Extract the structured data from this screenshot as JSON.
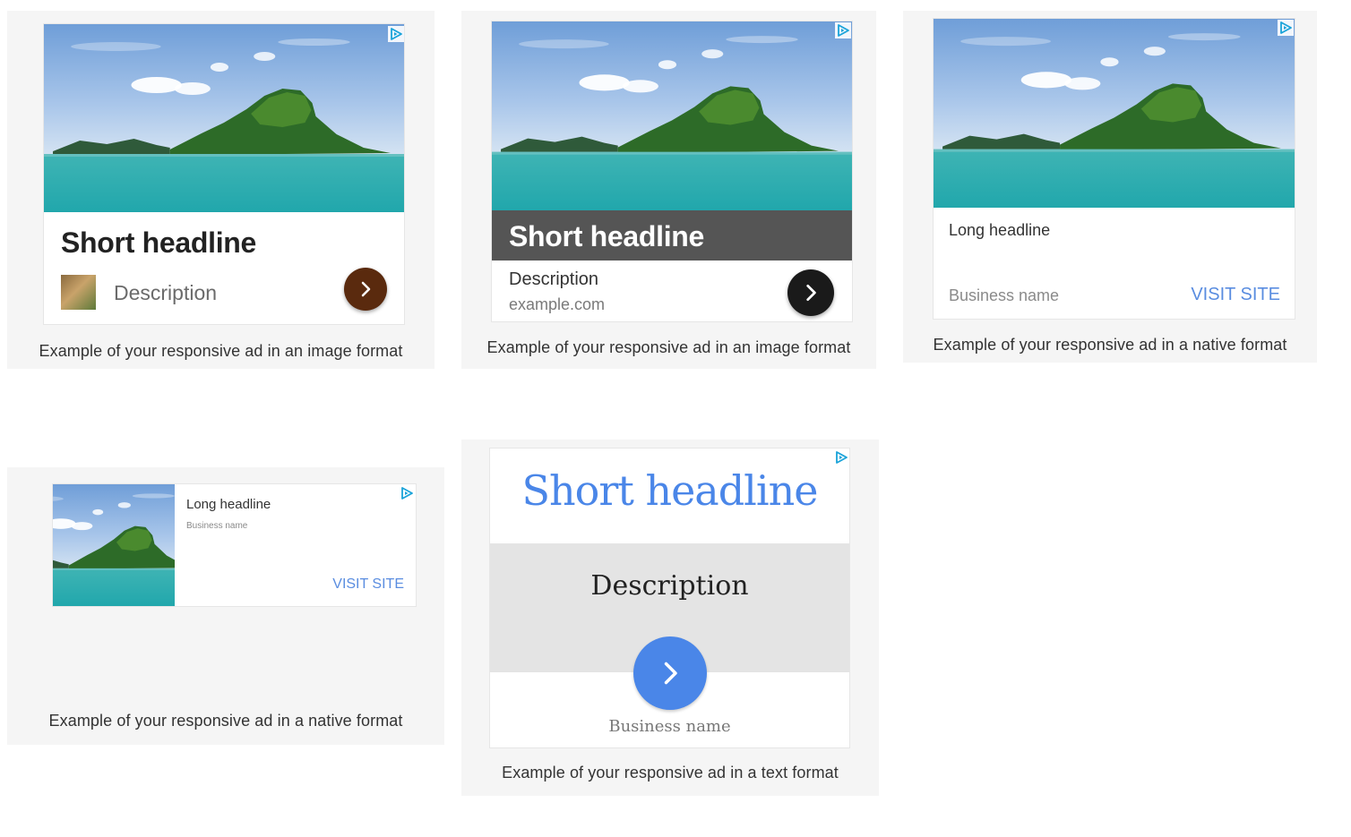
{
  "colors": {
    "accent_blue": "#4a86e8",
    "link_blue": "#5a8de0",
    "dark_btn": "#1a1a1a",
    "brown_btn": "#5a2a0e",
    "banner_gray": "#555555"
  },
  "ads": [
    {
      "format": "image",
      "headline": "Short headline",
      "description": "Description",
      "caption": "Example of your responsive ad in an image format",
      "icons": [
        "adchoices-icon",
        "chevron-right-icon",
        "thumbnail-icon"
      ]
    },
    {
      "format": "image",
      "headline": "Short headline",
      "description": "Description",
      "url": "example.com",
      "caption": "Example of your responsive ad in an image format",
      "icons": [
        "adchoices-icon",
        "chevron-right-icon"
      ]
    },
    {
      "format": "native",
      "headline": "Long headline",
      "business": "Business name",
      "cta": "VISIT SITE",
      "caption": "Example of your responsive ad in a native format",
      "icons": [
        "adchoices-icon"
      ]
    },
    {
      "format": "native",
      "headline": "Long headline",
      "business": "Business name",
      "cta": "VISIT SITE",
      "caption": "Example of your responsive ad in a native format",
      "icons": [
        "adchoices-icon"
      ]
    },
    {
      "format": "text",
      "headline": "Short headline",
      "description": "Description",
      "business": "Business name",
      "caption": "Example of your responsive ad in a text format",
      "icons": [
        "adchoices-icon",
        "chevron-right-icon"
      ]
    }
  ]
}
